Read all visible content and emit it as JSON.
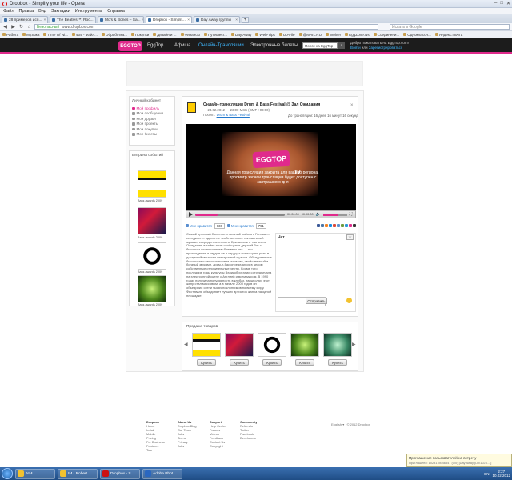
{
  "browser": {
    "window_title": "Dropbox - Simplify your life - Opera",
    "menu": [
      "Файл",
      "Правка",
      "Вид",
      "Закладки",
      "Инструменты",
      "Справка"
    ],
    "tabs": [
      {
        "label": "28 примеров исп...",
        "active": false
      },
      {
        "label": "The Beatles™: Roc...",
        "active": false
      },
      {
        "label": "Mo's & Bones – Sa...",
        "active": false
      },
      {
        "label": "Dropbox - Simplif...",
        "active": true
      },
      {
        "label": "Day Away группы",
        "active": false
      }
    ],
    "address": {
      "security": "Безопасный",
      "url": "www.dropbox.com"
    },
    "search_placeholder": "Искать в Google",
    "bookmarks": [
      "Работа",
      "Музыка",
      "Time Of Ni...",
      "404 - Файл...",
      "Обработка...",
      "Покупки",
      "Дизайн и ...",
      "Финансы",
      "Путешест...",
      "Day Away",
      "Web-Tips",
      "Up-File",
      "@MAIL.RU",
      "Wolver",
      "EggZone.ws",
      "Соединени...",
      "Одноклассн...",
      "Яндекс.Почта"
    ]
  },
  "site": {
    "logo": "EGGTOP",
    "nav": [
      {
        "label": "EggTop",
        "highlight": false
      },
      {
        "label": "Афиша",
        "highlight": false
      },
      {
        "label": "Онлайн-Трансляции",
        "highlight": true
      },
      {
        "label": "Электронные билеты",
        "highlight": false
      }
    ],
    "search_value": "Поиск на EggTop",
    "search_btn": "⌕",
    "welcome": "Добро пожаловать на EggTop.com!",
    "login": "Войти",
    "or": "или",
    "register": "Зарегистрироваться"
  },
  "cabinet": {
    "title": "Личный кабинет",
    "items": [
      {
        "label": "Мой профиль",
        "active": true
      },
      {
        "label": "Мои сообщения",
        "active": false
      },
      {
        "label": "Мои друзья",
        "active": false
      },
      {
        "label": "Мои проекты",
        "active": false
      },
      {
        "label": "Мои покупки",
        "active": false
      },
      {
        "label": "Мои билеты",
        "active": false
      }
    ]
  },
  "events_sidebar": {
    "title": "Витрина событий",
    "items": [
      {
        "caption": "Bass awards 2009"
      },
      {
        "caption": "Bass awards 2009"
      },
      {
        "caption": "Bass awards 2009"
      },
      {
        "caption": "Bass awards 2009"
      }
    ]
  },
  "event": {
    "title": "Онлайн-трансляция Drum & Bass Festival @ Зал Ожидания",
    "date": "— 24.02.2012 — 23:00 MSK (GMT +03:00)",
    "organizer_label": "Проект:",
    "organizer": "Drum & Bass Festival",
    "status": "До трансляции: 16 дней 16 минут 16 секунд",
    "close": "×",
    "video_logo": "EGGTOP",
    "video_badge": "TV",
    "video_message": "Данная трансляция закрыта для вашего региона, просмотр записи трансляции будет доступен с завтрашнего дня",
    "time_current": "00:00:00",
    "time_total": "00:00:00",
    "progress": 0.25,
    "volume": 0.6,
    "like_label": "Мне нравится",
    "like_count": "636",
    "dislike_label": "Мне нравится",
    "dislike_count": "791",
    "share_colors": [
      "#3b5998",
      "#4a76a8",
      "#f58220",
      "#168de2",
      "#dd4b39",
      "#5a8fd0",
      "#6e9a3c",
      "#2b99d6",
      "#e02a8c",
      "#333333"
    ],
    "description": "Самый длинный был ответственный работа с Голова — середина — одного из «собственных» направлений музыки, сосредоточенного на Британии и в том числе Ожидания, в хайпе этим сообщения дерзкий бит с быстрым соотношением бремени она — это прохождение и сердце ее в сердцах воплощают ритм в доступной мягкости электронной музыки. Объединенные быстрыми и гипнотическими ритмами, свойственный и богатый звуками, драм-н-бас определился в целом собственные отличительные черты. Кроме того, последние годы культуры Великобритании сотрудничала на электронной сцене с Англией и всем миром. В 1990 годах получила популярность в клубах, танцполах, этот жанр стал массовым, а в начале 2000 годов он объединил сотни тысяч поклонников по всему миру. Фестиваль объединяет лучших артистов жанра на одной площадке."
  },
  "chat": {
    "title": "Чат",
    "btn": "☆",
    "send": "Отправить"
  },
  "sales": {
    "title": "Продажа товаров",
    "prev": "◀",
    "next": "▶",
    "buy_label": "Купить",
    "items": [
      {
        "buy": "Купить"
      },
      {
        "buy": "Купить"
      },
      {
        "buy": "Купить"
      },
      {
        "buy": "Купить"
      },
      {
        "buy": "Купить"
      }
    ]
  },
  "footer": {
    "cols": [
      {
        "title": "Dropbox",
        "links": [
          "Home",
          "Install",
          "Mobile",
          "Pricing",
          "For Business",
          "Features",
          "Tour"
        ]
      },
      {
        "title": "About Us",
        "links": [
          "Dropbox Blog",
          "Our Team",
          "Jobs",
          "Terms",
          "Privacy",
          "Jobs"
        ]
      },
      {
        "title": "Support",
        "links": [
          "Help Center",
          "Forums",
          "Videos",
          "Feedback",
          "Contact Us",
          "Copyright"
        ]
      },
      {
        "title": "Community",
        "links": [
          "Referrals",
          "Twitter",
          "Facebook",
          "Developers"
        ]
      }
    ],
    "lang": "English",
    "copyright": "© 2012 Dropbox"
  },
  "toast": {
    "title": "Приглашения пользователей на встречу",
    "sub": "Приглашено: 10231 из 46347 (0/0) [Day Away (DJ/1023...)]"
  },
  "taskbar": {
    "items": [
      {
        "label": "AIM",
        "color": "#f2c230"
      },
      {
        "label": "IM - Robert...",
        "color": "#f2c230"
      },
      {
        "label": "Dropbox - S...",
        "color": "#cc1111"
      },
      {
        "label": "Adobe Phot...",
        "color": "#2a67c0"
      }
    ],
    "lang": "EN",
    "time": "2:27",
    "date": "10.02.2012"
  }
}
